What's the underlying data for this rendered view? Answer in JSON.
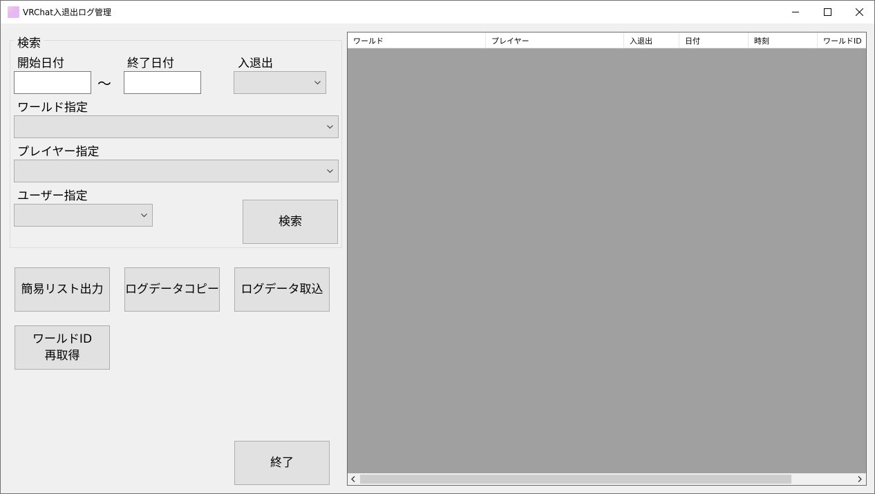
{
  "window": {
    "title": "VRChat入退出ログ管理"
  },
  "search": {
    "group_title": "検索",
    "start_date_label": "開始日付",
    "start_date_value": "",
    "tilde": "〜",
    "end_date_label": "終了日付",
    "end_date_value": "",
    "inout_label": "入退出",
    "inout_selected": "",
    "world_label": "ワールド指定",
    "world_selected": "",
    "player_label": "プレイヤー指定",
    "player_selected": "",
    "user_label": "ユーザー指定",
    "user_selected": "",
    "search_button": "検索"
  },
  "actions": {
    "simple_list_button": "簡易リスト出力",
    "log_copy_button": "ログデータコピー",
    "log_import_button": "ログデータ取込",
    "world_id_refetch_line1": "ワールドID",
    "world_id_refetch_line2": "再取得",
    "exit_button": "終了"
  },
  "grid": {
    "columns": [
      "ワールド",
      "プレイヤー",
      "入退出",
      "日付",
      "時刻",
      "ワールドID"
    ],
    "rows": []
  },
  "icons": {
    "minimize": "minimize-icon",
    "maximize": "maximize-icon",
    "close": "close-icon",
    "dropdown": "chevron-down-icon",
    "scroll_left": "chevron-left-icon",
    "scroll_right": "chevron-right-icon"
  },
  "colors": {
    "window_bg": "#f0f0f0",
    "button_bg": "#e1e1e1",
    "grid_bg": "#a0a0a0"
  }
}
